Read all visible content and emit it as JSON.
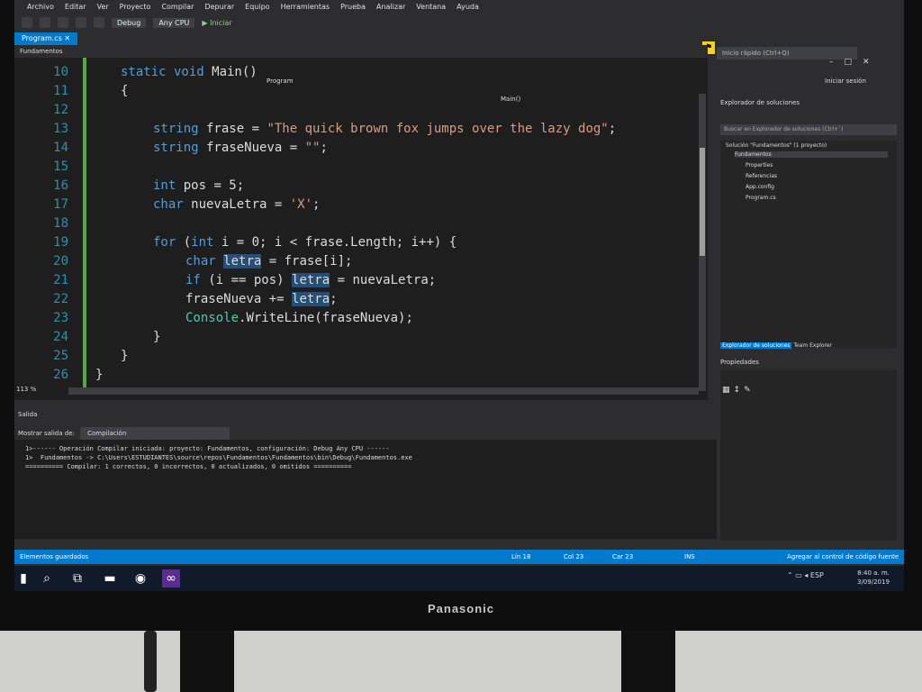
{
  "menu": [
    "Archivo",
    "Editar",
    "Ver",
    "Proyecto",
    "Compilar",
    "Depurar",
    "Equipo",
    "Herramientas",
    "Prueba",
    "Analizar",
    "Ventana",
    "Ayuda"
  ],
  "toolbar": {
    "config": "Debug",
    "platform": "Any CPU",
    "start_label": "Iniciar"
  },
  "quick_launch": "Inicio rápido (Ctrl+Q)",
  "sign_in": "Iniciar sesión",
  "tab": {
    "label": "Program.cs"
  },
  "nav": {
    "project": "Fundamentos",
    "type": "Program",
    "member": "Main()"
  },
  "editor": {
    "zoom": "113 %",
    "lines": [
      {
        "n": "10"
      },
      {
        "n": "11"
      },
      {
        "n": "12"
      },
      {
        "n": "13"
      },
      {
        "n": "14"
      },
      {
        "n": "15"
      },
      {
        "n": "16"
      },
      {
        "n": "17"
      },
      {
        "n": "18"
      },
      {
        "n": "19"
      },
      {
        "n": "20"
      },
      {
        "n": "21"
      },
      {
        "n": "22"
      },
      {
        "n": "23"
      },
      {
        "n": "24"
      },
      {
        "n": "25"
      },
      {
        "n": "26"
      }
    ],
    "code": {
      "l10_kw": "static void",
      "l10_rest": " Main()",
      "l11": "{",
      "l13_kw": "string",
      "l13_mid": " frase = ",
      "l13_str": "\"The quick brown fox jumps over the lazy dog\"",
      "l13_end": ";",
      "l14_kw": "string",
      "l14_mid": " fraseNueva = ",
      "l14_str": "\"\"",
      "l14_end": ";",
      "l15_kw": "int",
      "l15_rest": " pos = 5;",
      "l16_kw": "char",
      "l16_mid": " nuevaLetra = ",
      "l16_str": "'X'",
      "l16_end": ";",
      "l19_kw": "for",
      "l19_a": " (",
      "l19_kw2": "int",
      "l19_rest": " i = 0; i < frase.Length; i++) {",
      "l20_kw": "char",
      "l20_hl": "letra",
      "l20_rest": " = frase[i];",
      "l21_kw": "if",
      "l21_mid": " (i == pos) ",
      "l21_hl": "letra",
      "l21_rest": " = nuevaLetra;",
      "l22_mid": "fraseNueva += ",
      "l22_hl": "letra",
      "l22_end": ";",
      "l23_typ": "Console",
      "l23_rest": ".WriteLine(fraseNueva);",
      "l24": "}",
      "l25": "}",
      "l26": "}"
    }
  },
  "output": {
    "title": "Salida",
    "show_label": "Mostrar salida de:",
    "source": "Compilación",
    "lines": [
      "1>------ Operación Compilar iniciada: proyecto: Fundamentos, configuración: Debug Any CPU ------",
      "1>  Fundamentos -> C:\\Users\\ESTUDIANTES\\source\\repos\\Fundamentos\\Fundamentos\\bin\\Debug\\Fundamentos.exe",
      "========== Compilar: 1 correctos, 0 incorrectos, 0 actualizados, 0 omitidos =========="
    ]
  },
  "solution_explorer": {
    "title": "Explorador de soluciones",
    "search_placeholder": "Buscar en Explorador de soluciones (Ctrl+`)",
    "nodes": [
      "Solución \"Fundamentos\" (1 proyecto)",
      "Fundamentos",
      "Properties",
      "Referencias",
      "App.config",
      "Program.cs"
    ],
    "tabs": [
      "Explorador de soluciones",
      "Team Explorer"
    ]
  },
  "properties": {
    "title": "Propiedades"
  },
  "status": {
    "left": "Elementos guardados",
    "ln": "Lín 18",
    "col": "Col 23",
    "car": "Car 23",
    "ins": "INS",
    "right": "Agregar al control de código fuente"
  },
  "taskbar": {
    "lang": "ESP",
    "time": "8:40 a. m.",
    "date": "3/09/2019"
  },
  "monitor_brand": "Panasonic"
}
